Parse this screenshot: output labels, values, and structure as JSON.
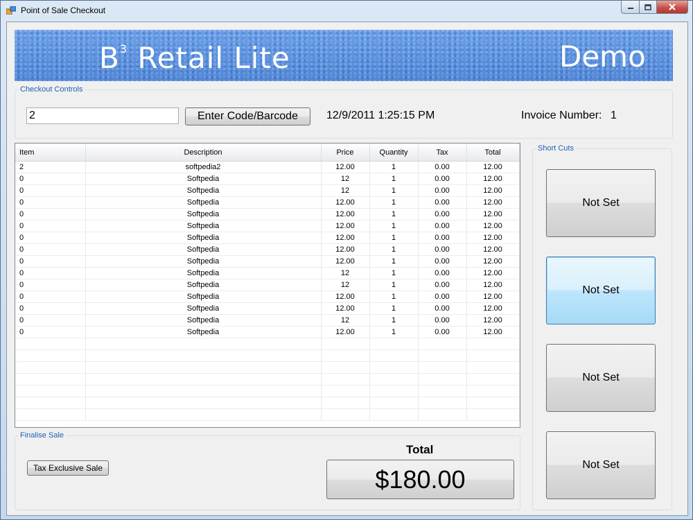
{
  "window": {
    "title": "Point of Sale Checkout"
  },
  "banner": {
    "title": "B",
    "superscript": "3",
    "title_rest": " Retail Lite",
    "edition": "Demo"
  },
  "checkout": {
    "legend": "Checkout Controls",
    "code_value": "2",
    "enter_label": "Enter Code/Barcode",
    "datetime": "12/9/2011 1:25:15 PM",
    "invoice_label": "Invoice Number:",
    "invoice_number": "1"
  },
  "grid": {
    "columns": [
      "Item",
      "Description",
      "Price",
      "Quantity",
      "Tax",
      "Total"
    ],
    "rows": [
      [
        "2",
        "softpedia2",
        "12.00",
        "1",
        "0.00",
        "12.00"
      ],
      [
        "0",
        "Softpedia",
        "12",
        "1",
        "0.00",
        "12.00"
      ],
      [
        "0",
        "Softpedia",
        "12",
        "1",
        "0.00",
        "12.00"
      ],
      [
        "0",
        "Softpedia",
        "12.00",
        "1",
        "0.00",
        "12.00"
      ],
      [
        "0",
        "Softpedia",
        "12.00",
        "1",
        "0.00",
        "12.00"
      ],
      [
        "0",
        "Softpedia",
        "12.00",
        "1",
        "0.00",
        "12.00"
      ],
      [
        "0",
        "Softpedia",
        "12.00",
        "1",
        "0.00",
        "12.00"
      ],
      [
        "0",
        "Softpedia",
        "12.00",
        "1",
        "0.00",
        "12.00"
      ],
      [
        "0",
        "Softpedia",
        "12.00",
        "1",
        "0.00",
        "12.00"
      ],
      [
        "0",
        "Softpedia",
        "12",
        "1",
        "0.00",
        "12.00"
      ],
      [
        "0",
        "Softpedia",
        "12",
        "1",
        "0.00",
        "12.00"
      ],
      [
        "0",
        "Softpedia",
        "12.00",
        "1",
        "0.00",
        "12.00"
      ],
      [
        "0",
        "Softpedia",
        "12.00",
        "1",
        "0.00",
        "12.00"
      ],
      [
        "0",
        "Softpedia",
        "12",
        "1",
        "0.00",
        "12.00"
      ],
      [
        "0",
        "Softpedia",
        "12.00",
        "1",
        "0.00",
        "12.00"
      ]
    ]
  },
  "shortcuts": {
    "legend": "Short Cuts",
    "buttons": [
      "Not Set",
      "Not Set",
      "Not Set",
      "Not Set"
    ]
  },
  "finalise": {
    "legend": "Finalise Sale",
    "tax_button": "Tax Exclusive Sale",
    "total_label": "Total",
    "total_value": "$180.00"
  },
  "icons": {
    "app": "app-window-icon",
    "minimize": "minimize-icon",
    "maximize": "maximize-icon",
    "close": "close-icon"
  },
  "colors": {
    "accent_legend": "#1d5fb6",
    "banner": "#5f95e2",
    "close": "#c75050"
  }
}
